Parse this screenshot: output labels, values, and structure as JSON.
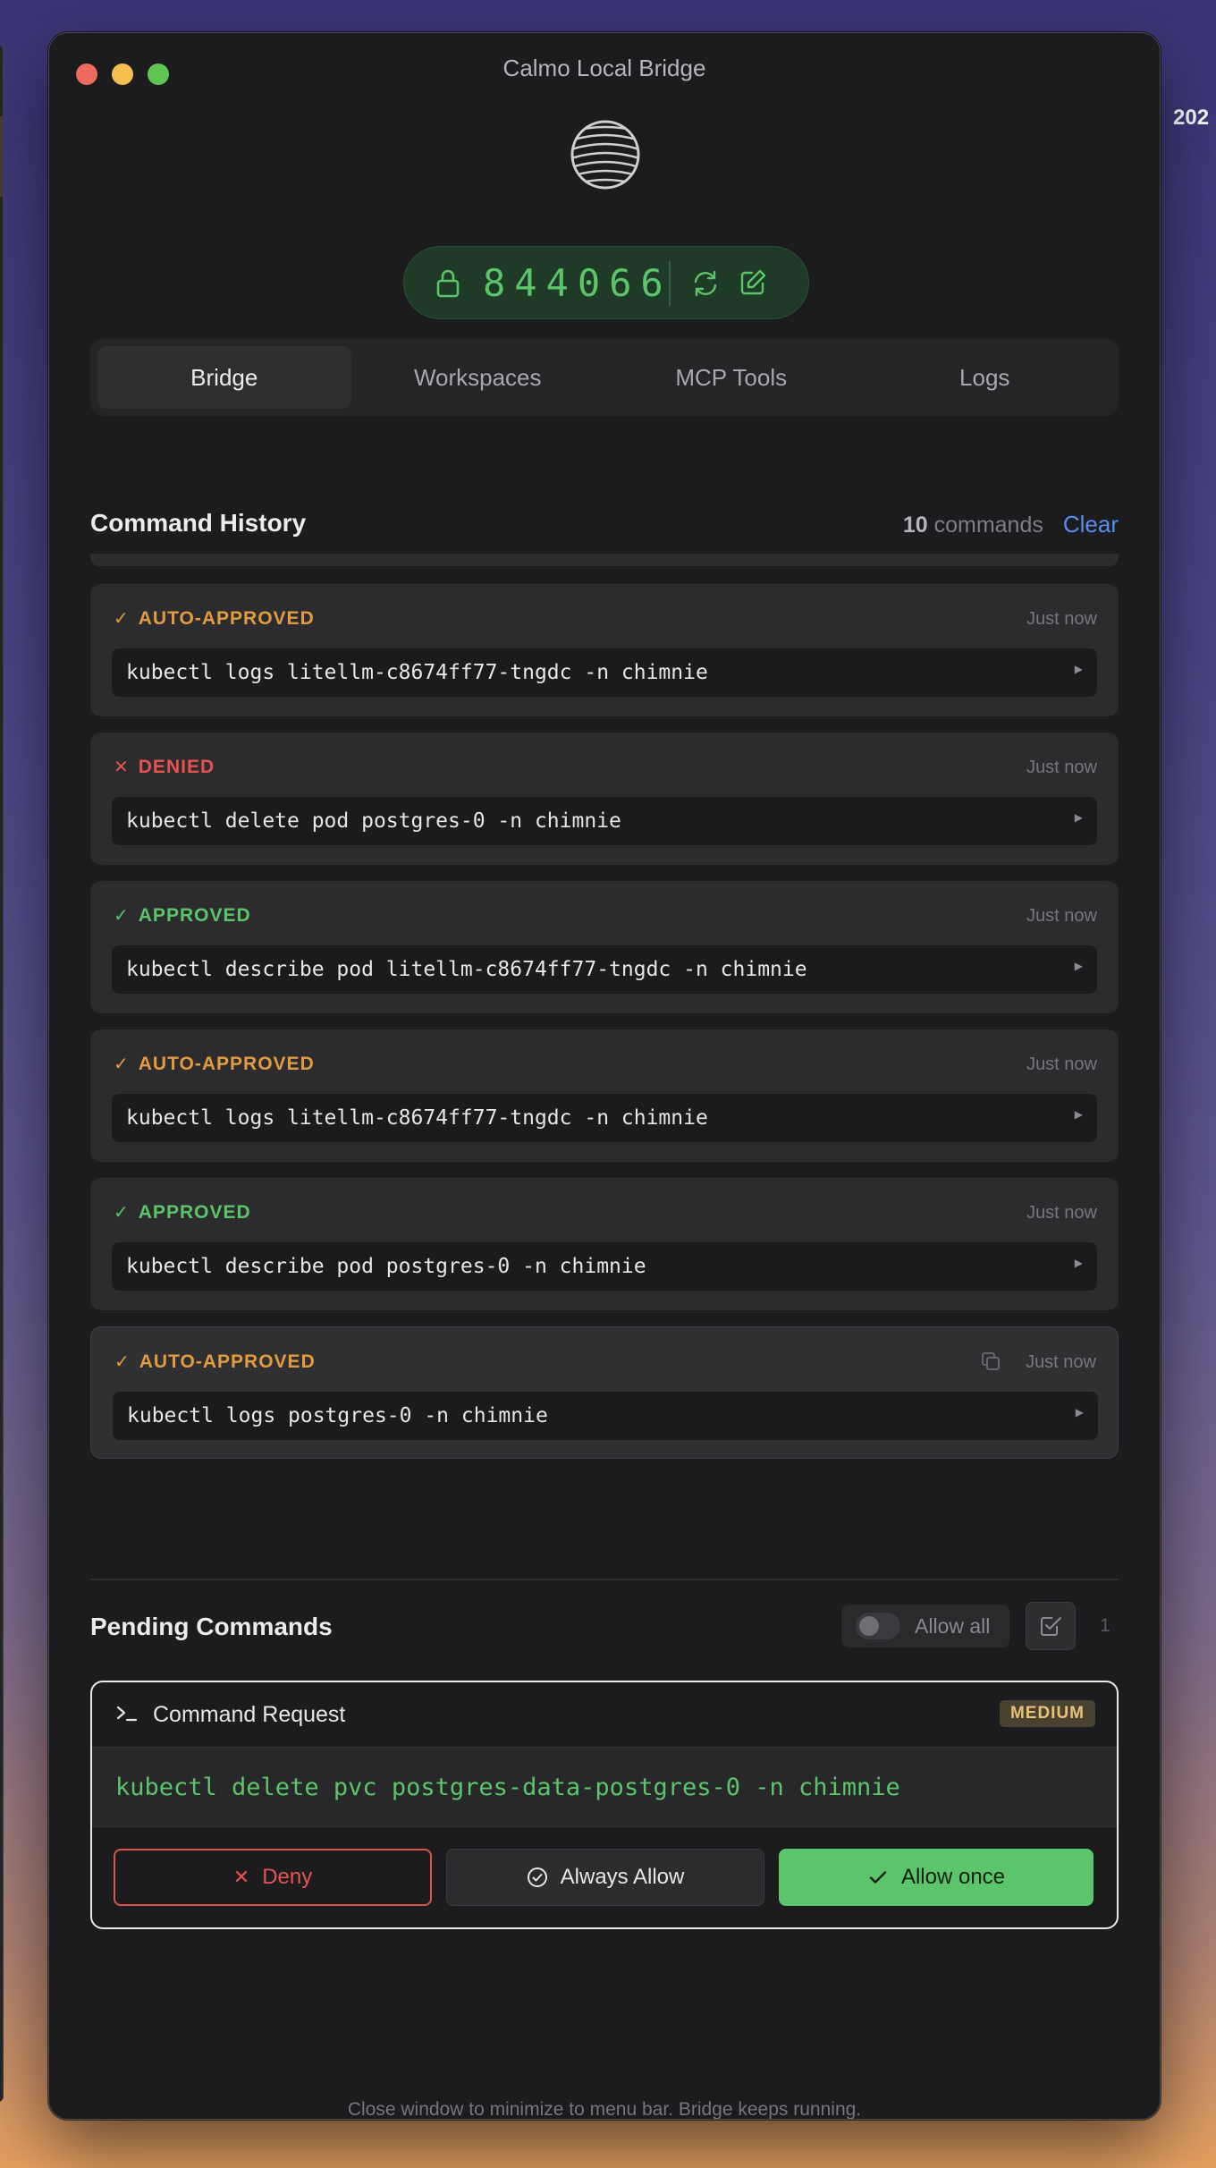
{
  "window": {
    "title": "Calmo Local Bridge"
  },
  "pin": {
    "code": "844066"
  },
  "tabs": [
    {
      "label": "Bridge",
      "active": true
    },
    {
      "label": "Workspaces",
      "active": false
    },
    {
      "label": "MCP Tools",
      "active": false
    },
    {
      "label": "Logs",
      "active": false
    }
  ],
  "history": {
    "title": "Command History",
    "count": "10",
    "count_label": "commands",
    "clear_label": "Clear",
    "items": [
      {
        "status": "AUTO-APPROVED",
        "kind": "auto",
        "time": "Just now",
        "command": "kubectl logs litellm-c8674ff77-tngdc -n chimnie"
      },
      {
        "status": "DENIED",
        "kind": "denied",
        "time": "Just now",
        "command": "kubectl delete pod postgres-0 -n chimnie"
      },
      {
        "status": "APPROVED",
        "kind": "approved",
        "time": "Just now",
        "command": "kubectl describe pod litellm-c8674ff77-tngdc -n chimnie"
      },
      {
        "status": "AUTO-APPROVED",
        "kind": "auto",
        "time": "Just now",
        "command": "kubectl logs litellm-c8674ff77-tngdc -n chimnie"
      },
      {
        "status": "APPROVED",
        "kind": "approved",
        "time": "Just now",
        "command": "kubectl describe pod postgres-0 -n chimnie"
      },
      {
        "status": "AUTO-APPROVED",
        "kind": "auto",
        "time": "Just now",
        "command": "kubectl logs postgres-0 -n chimnie"
      }
    ]
  },
  "pending": {
    "title": "Pending Commands",
    "allow_all_label": "Allow all",
    "allow_all_enabled": false,
    "count": "1",
    "request": {
      "title": "Command Request",
      "risk": "MEDIUM",
      "command": "kubectl delete pvc postgres-data-postgres-0 -n chimnie",
      "deny_label": "Deny",
      "always_allow_label": "Always Allow",
      "allow_once_label": "Allow once"
    }
  },
  "footer": {
    "note": "Close window to minimize to menu bar. Bridge keeps running."
  },
  "colors": {
    "accent_green": "#5cc46a",
    "auto_approved": "#e39b3f",
    "denied": "#e5544f",
    "link_blue": "#5b8cf0"
  },
  "background_text": "202"
}
